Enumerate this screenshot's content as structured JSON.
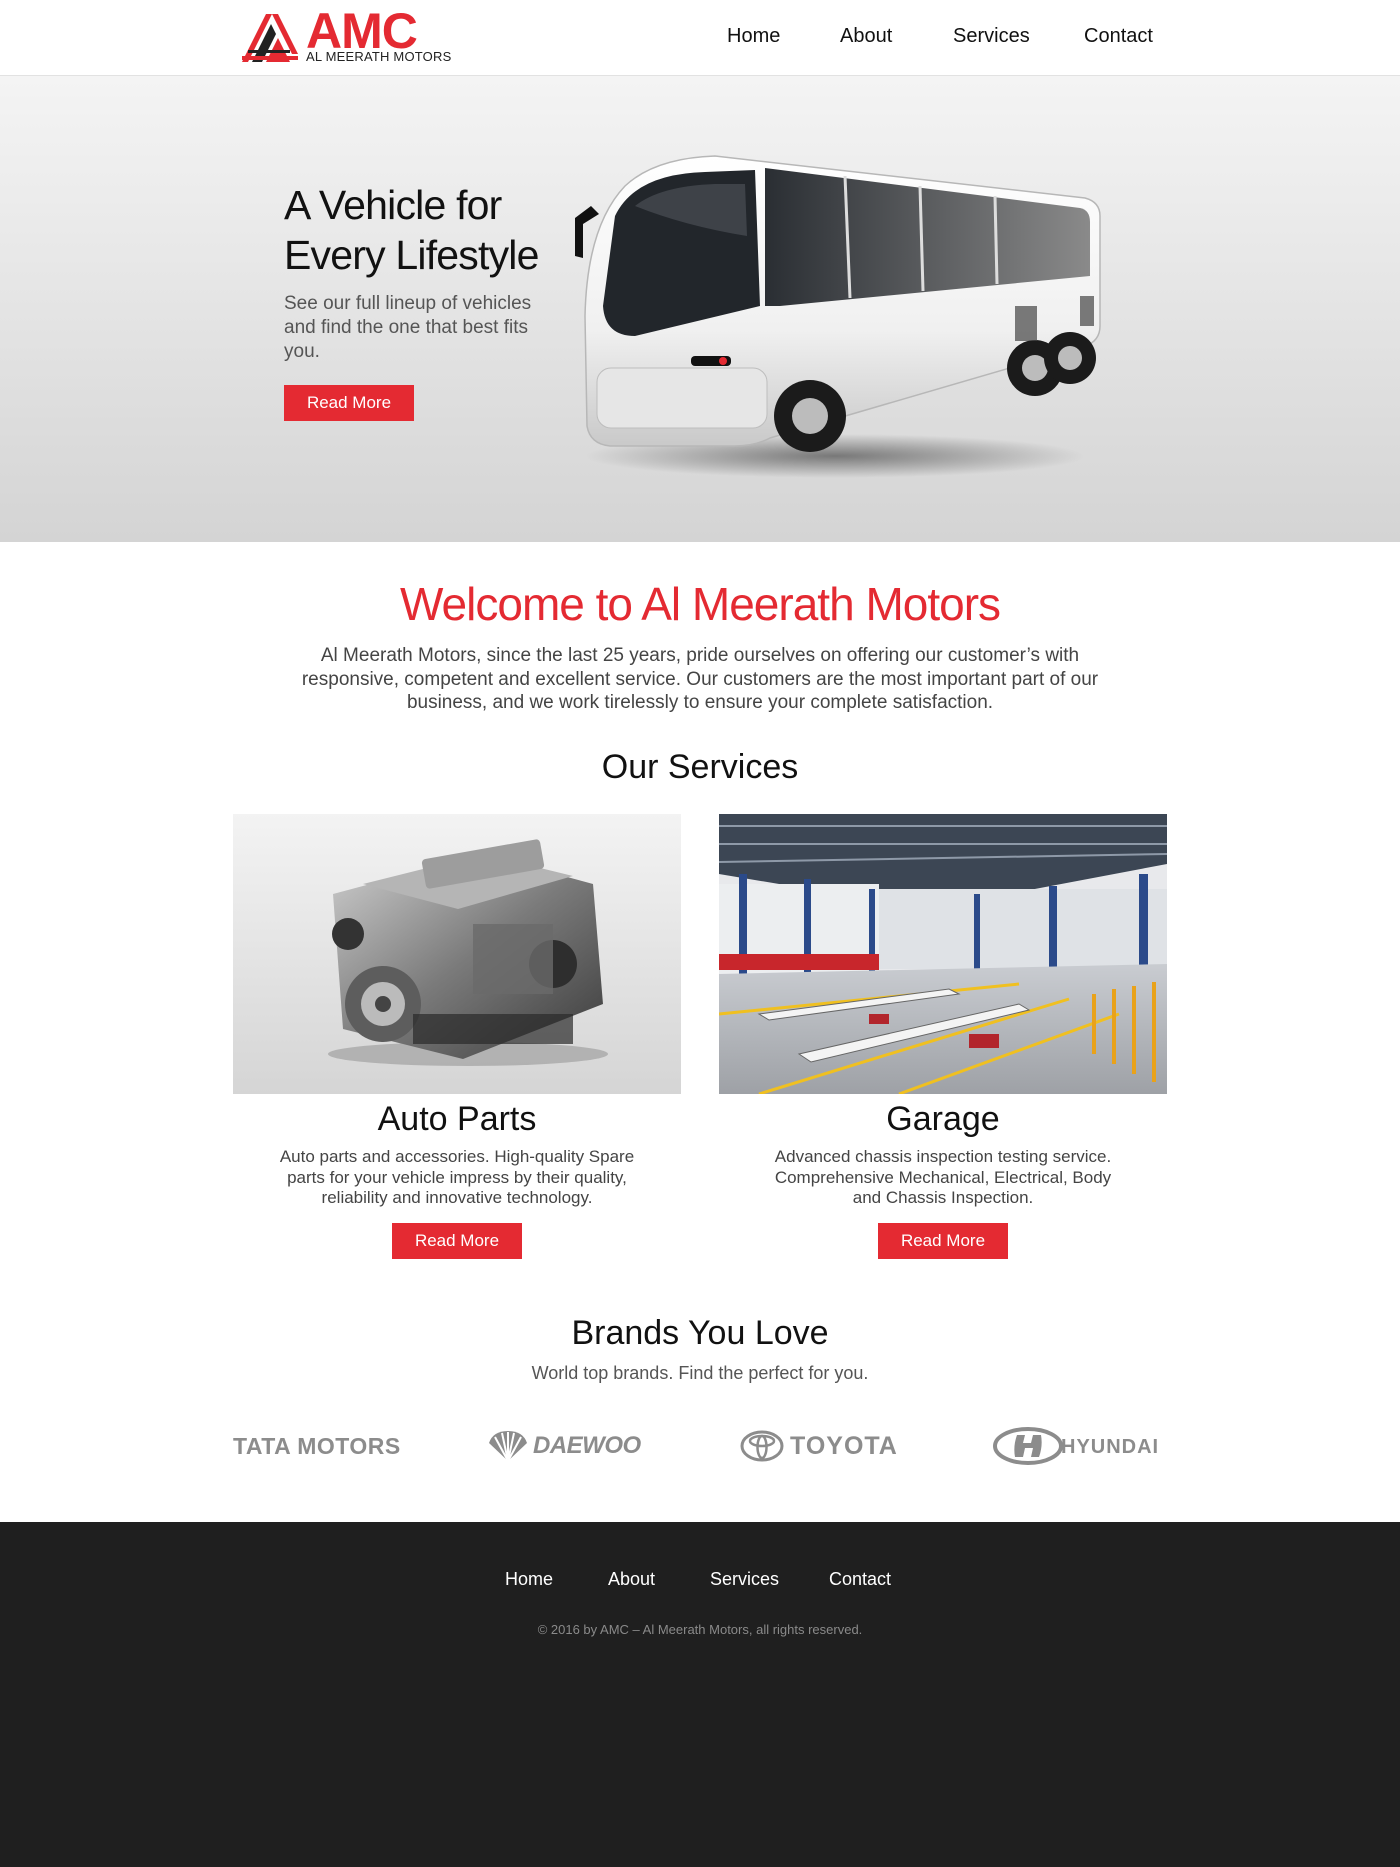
{
  "header": {
    "logo_text": "AMC",
    "logo_subtext": "AL MEERATH MOTORS",
    "nav": [
      "Home",
      "About",
      "Services",
      "Contact"
    ]
  },
  "hero": {
    "title_line1": "A Vehicle for",
    "title_line2": "Every Lifestyle",
    "text": "See our full lineup of vehicles and find the one that best fits you.",
    "button": "Read More",
    "image": "coach-bus-photo"
  },
  "welcome": {
    "title": "Welcome to Al Meerath Motors",
    "text": "Al Meerath Motors, since the last 25 years, pride ourselves on offering our customer’s with responsive, competent and excellent service. Our customers are the most important part of our business, and we work tirelessly to ensure your complete satisfaction."
  },
  "services": {
    "title": "Our Services",
    "items": [
      {
        "title": "Auto Parts",
        "text": "Auto parts and accessories. High-quality Spare parts for your vehicle impress by their quality, reliability and innovative technology.",
        "button": "Read More",
        "image": "engine-photo"
      },
      {
        "title": "Garage",
        "text": "Advanced chassis inspection testing service. Comprehensive Mechanical, Electrical, Body and Chassis Inspection.",
        "button": "Read More",
        "image": "garage-photo"
      }
    ]
  },
  "brands": {
    "title": "Brands You Love",
    "subtitle": "World top brands. Find the perfect for you.",
    "logos": [
      "TATA MOTORS",
      "DAEWOO",
      "TOYOTA",
      "HYUNDAI"
    ]
  },
  "footer": {
    "nav": [
      "Home",
      "About",
      "Services",
      "Contact"
    ],
    "copyright": "© 2016 by AMC – Al Meerath Motors, all rights reserved."
  },
  "colors": {
    "brand_red": "#e42a32",
    "footer_bg": "#1f1f1f",
    "text_dark": "#111111",
    "brand_logo_gray": "#8c8c8c"
  }
}
